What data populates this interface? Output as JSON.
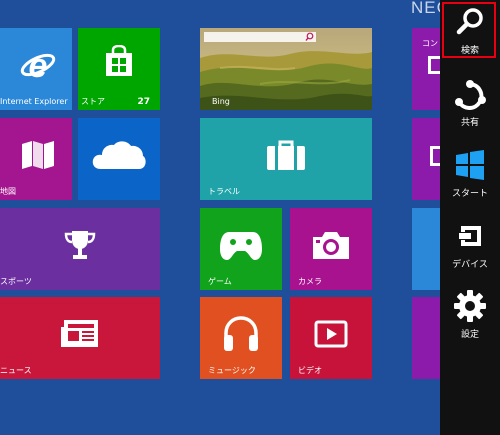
{
  "user": {
    "name": "NEC"
  },
  "tiles": {
    "ie": {
      "label": "Internet Explorer",
      "color": "#2b87d8",
      "icon": "internet-explorer-icon"
    },
    "store": {
      "label": "ストア",
      "badge": "27",
      "color": "#00a600",
      "icon": "store-bag-icon"
    },
    "bing": {
      "label": "Bing",
      "color": "#5e6b32",
      "icon": "search-icon"
    },
    "partial_top": {
      "label": "コン",
      "color": "#8c1bab"
    },
    "maps": {
      "label": "地図",
      "color": "#a4168f",
      "icon": "map-icon"
    },
    "skydrive": {
      "label": "",
      "color": "#0b64c8",
      "icon": "cloud-icon"
    },
    "travel": {
      "label": "トラベル",
      "color": "#1fa3a8",
      "icon": "suitcase-icon"
    },
    "sports": {
      "label": "スポーツ",
      "color": "#6b2fa0",
      "icon": "trophy-icon"
    },
    "games": {
      "label": "ゲーム",
      "color": "#11a31c",
      "icon": "gamepad-icon"
    },
    "camera": {
      "label": "カメラ",
      "color": "#a8128f",
      "icon": "camera-icon"
    },
    "news": {
      "label": "ニュース",
      "color": "#c8173b",
      "icon": "newspaper-icon"
    },
    "music": {
      "label": "ミュージック",
      "color": "#e15020",
      "icon": "headphones-icon"
    },
    "video": {
      "label": "ビデオ",
      "color": "#c7123a",
      "icon": "video-play-icon"
    }
  },
  "charms": [
    {
      "label": "検索",
      "icon": "search-icon",
      "selected": true
    },
    {
      "label": "共有",
      "icon": "share-icon",
      "selected": false
    },
    {
      "label": "スタート",
      "icon": "windows-logo-icon",
      "selected": false
    },
    {
      "label": "デバイス",
      "icon": "devices-icon",
      "selected": false
    },
    {
      "label": "設定",
      "icon": "gear-icon",
      "selected": false
    }
  ],
  "colors": {
    "background": "#1f4e9a",
    "charm_bar": "#111111",
    "selection": "#e60012"
  }
}
